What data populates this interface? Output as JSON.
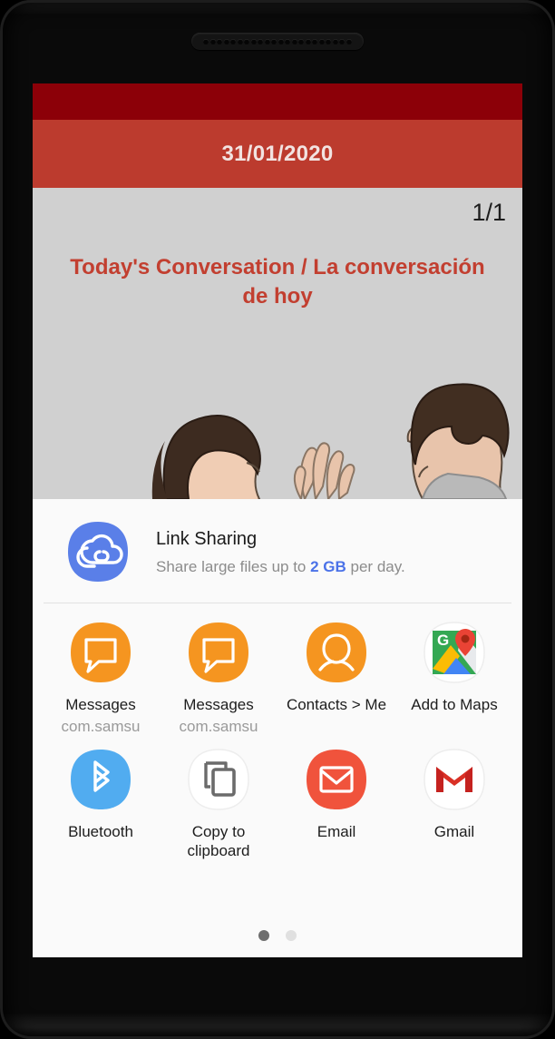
{
  "device": {
    "earpiece_hole_count": 22
  },
  "app": {
    "status_bar_color": "#8c0008",
    "action_bar_color": "#bc3b2e",
    "date": "31/01/2020",
    "page_counter": "1/1",
    "headline": "Today's Conversation / La conversación de hoy",
    "content_bg": "#d0d0d0",
    "headline_color": "#c23f30"
  },
  "share_sheet": {
    "link_sharing": {
      "icon": "cloud-link-icon",
      "title": "Link Sharing",
      "subtitle_before": "Share large files up to ",
      "subtitle_highlight": "2 GB",
      "subtitle_after": " per day.",
      "highlight_color": "#4b72e8"
    },
    "targets": [
      {
        "icon": "messages-icon",
        "label": "Messages",
        "sublabel": "com.samsu",
        "color": "#f59520"
      },
      {
        "icon": "messages-icon",
        "label": "Messages",
        "sublabel": "com.samsu",
        "color": "#f59520"
      },
      {
        "icon": "contacts-icon",
        "label": "Contacts > Me",
        "sublabel": "",
        "color": "#f59520"
      },
      {
        "icon": "google-maps-icon",
        "label": "Add to Maps",
        "sublabel": "",
        "color": "#ffffff"
      },
      {
        "icon": "bluetooth-icon",
        "label": "Bluetooth",
        "sublabel": "",
        "color": "#51acf0"
      },
      {
        "icon": "copy-clipboard-icon",
        "label": "Copy to clipboard",
        "sublabel": "",
        "color": "#ffffff"
      },
      {
        "icon": "email-icon",
        "label": "Email",
        "sublabel": "",
        "color": "#f0533c"
      },
      {
        "icon": "gmail-icon",
        "label": "Gmail",
        "sublabel": "",
        "color": "#ffffff"
      }
    ],
    "pagination": {
      "total": 2,
      "active_index": 0
    }
  }
}
